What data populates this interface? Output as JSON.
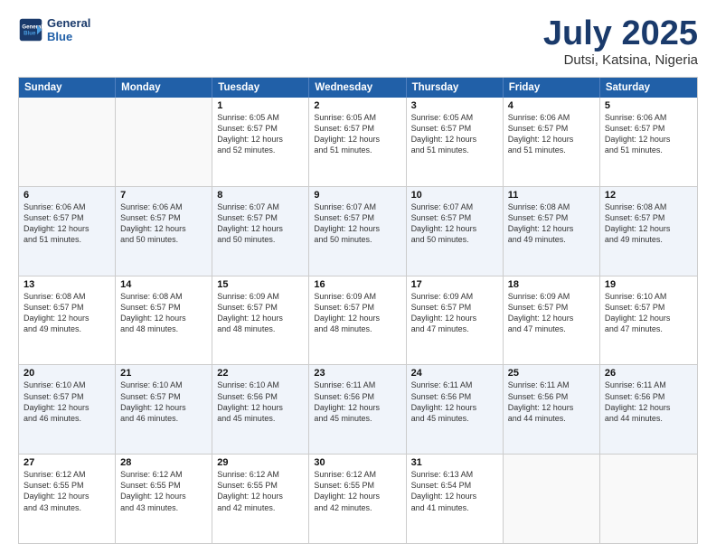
{
  "header": {
    "logo_line1": "General",
    "logo_line2": "Blue",
    "month": "July 2025",
    "location": "Dutsi, Katsina, Nigeria"
  },
  "weekdays": [
    "Sunday",
    "Monday",
    "Tuesday",
    "Wednesday",
    "Thursday",
    "Friday",
    "Saturday"
  ],
  "rows": [
    [
      {
        "day": "",
        "lines": []
      },
      {
        "day": "",
        "lines": []
      },
      {
        "day": "1",
        "lines": [
          "Sunrise: 6:05 AM",
          "Sunset: 6:57 PM",
          "Daylight: 12 hours",
          "and 52 minutes."
        ]
      },
      {
        "day": "2",
        "lines": [
          "Sunrise: 6:05 AM",
          "Sunset: 6:57 PM",
          "Daylight: 12 hours",
          "and 51 minutes."
        ]
      },
      {
        "day": "3",
        "lines": [
          "Sunrise: 6:05 AM",
          "Sunset: 6:57 PM",
          "Daylight: 12 hours",
          "and 51 minutes."
        ]
      },
      {
        "day": "4",
        "lines": [
          "Sunrise: 6:06 AM",
          "Sunset: 6:57 PM",
          "Daylight: 12 hours",
          "and 51 minutes."
        ]
      },
      {
        "day": "5",
        "lines": [
          "Sunrise: 6:06 AM",
          "Sunset: 6:57 PM",
          "Daylight: 12 hours",
          "and 51 minutes."
        ]
      }
    ],
    [
      {
        "day": "6",
        "lines": [
          "Sunrise: 6:06 AM",
          "Sunset: 6:57 PM",
          "Daylight: 12 hours",
          "and 51 minutes."
        ]
      },
      {
        "day": "7",
        "lines": [
          "Sunrise: 6:06 AM",
          "Sunset: 6:57 PM",
          "Daylight: 12 hours",
          "and 50 minutes."
        ]
      },
      {
        "day": "8",
        "lines": [
          "Sunrise: 6:07 AM",
          "Sunset: 6:57 PM",
          "Daylight: 12 hours",
          "and 50 minutes."
        ]
      },
      {
        "day": "9",
        "lines": [
          "Sunrise: 6:07 AM",
          "Sunset: 6:57 PM",
          "Daylight: 12 hours",
          "and 50 minutes."
        ]
      },
      {
        "day": "10",
        "lines": [
          "Sunrise: 6:07 AM",
          "Sunset: 6:57 PM",
          "Daylight: 12 hours",
          "and 50 minutes."
        ]
      },
      {
        "day": "11",
        "lines": [
          "Sunrise: 6:08 AM",
          "Sunset: 6:57 PM",
          "Daylight: 12 hours",
          "and 49 minutes."
        ]
      },
      {
        "day": "12",
        "lines": [
          "Sunrise: 6:08 AM",
          "Sunset: 6:57 PM",
          "Daylight: 12 hours",
          "and 49 minutes."
        ]
      }
    ],
    [
      {
        "day": "13",
        "lines": [
          "Sunrise: 6:08 AM",
          "Sunset: 6:57 PM",
          "Daylight: 12 hours",
          "and 49 minutes."
        ]
      },
      {
        "day": "14",
        "lines": [
          "Sunrise: 6:08 AM",
          "Sunset: 6:57 PM",
          "Daylight: 12 hours",
          "and 48 minutes."
        ]
      },
      {
        "day": "15",
        "lines": [
          "Sunrise: 6:09 AM",
          "Sunset: 6:57 PM",
          "Daylight: 12 hours",
          "and 48 minutes."
        ]
      },
      {
        "day": "16",
        "lines": [
          "Sunrise: 6:09 AM",
          "Sunset: 6:57 PM",
          "Daylight: 12 hours",
          "and 48 minutes."
        ]
      },
      {
        "day": "17",
        "lines": [
          "Sunrise: 6:09 AM",
          "Sunset: 6:57 PM",
          "Daylight: 12 hours",
          "and 47 minutes."
        ]
      },
      {
        "day": "18",
        "lines": [
          "Sunrise: 6:09 AM",
          "Sunset: 6:57 PM",
          "Daylight: 12 hours",
          "and 47 minutes."
        ]
      },
      {
        "day": "19",
        "lines": [
          "Sunrise: 6:10 AM",
          "Sunset: 6:57 PM",
          "Daylight: 12 hours",
          "and 47 minutes."
        ]
      }
    ],
    [
      {
        "day": "20",
        "lines": [
          "Sunrise: 6:10 AM",
          "Sunset: 6:57 PM",
          "Daylight: 12 hours",
          "and 46 minutes."
        ]
      },
      {
        "day": "21",
        "lines": [
          "Sunrise: 6:10 AM",
          "Sunset: 6:57 PM",
          "Daylight: 12 hours",
          "and 46 minutes."
        ]
      },
      {
        "day": "22",
        "lines": [
          "Sunrise: 6:10 AM",
          "Sunset: 6:56 PM",
          "Daylight: 12 hours",
          "and 45 minutes."
        ]
      },
      {
        "day": "23",
        "lines": [
          "Sunrise: 6:11 AM",
          "Sunset: 6:56 PM",
          "Daylight: 12 hours",
          "and 45 minutes."
        ]
      },
      {
        "day": "24",
        "lines": [
          "Sunrise: 6:11 AM",
          "Sunset: 6:56 PM",
          "Daylight: 12 hours",
          "and 45 minutes."
        ]
      },
      {
        "day": "25",
        "lines": [
          "Sunrise: 6:11 AM",
          "Sunset: 6:56 PM",
          "Daylight: 12 hours",
          "and 44 minutes."
        ]
      },
      {
        "day": "26",
        "lines": [
          "Sunrise: 6:11 AM",
          "Sunset: 6:56 PM",
          "Daylight: 12 hours",
          "and 44 minutes."
        ]
      }
    ],
    [
      {
        "day": "27",
        "lines": [
          "Sunrise: 6:12 AM",
          "Sunset: 6:55 PM",
          "Daylight: 12 hours",
          "and 43 minutes."
        ]
      },
      {
        "day": "28",
        "lines": [
          "Sunrise: 6:12 AM",
          "Sunset: 6:55 PM",
          "Daylight: 12 hours",
          "and 43 minutes."
        ]
      },
      {
        "day": "29",
        "lines": [
          "Sunrise: 6:12 AM",
          "Sunset: 6:55 PM",
          "Daylight: 12 hours",
          "and 42 minutes."
        ]
      },
      {
        "day": "30",
        "lines": [
          "Sunrise: 6:12 AM",
          "Sunset: 6:55 PM",
          "Daylight: 12 hours",
          "and 42 minutes."
        ]
      },
      {
        "day": "31",
        "lines": [
          "Sunrise: 6:13 AM",
          "Sunset: 6:54 PM",
          "Daylight: 12 hours",
          "and 41 minutes."
        ]
      },
      {
        "day": "",
        "lines": []
      },
      {
        "day": "",
        "lines": []
      }
    ]
  ]
}
